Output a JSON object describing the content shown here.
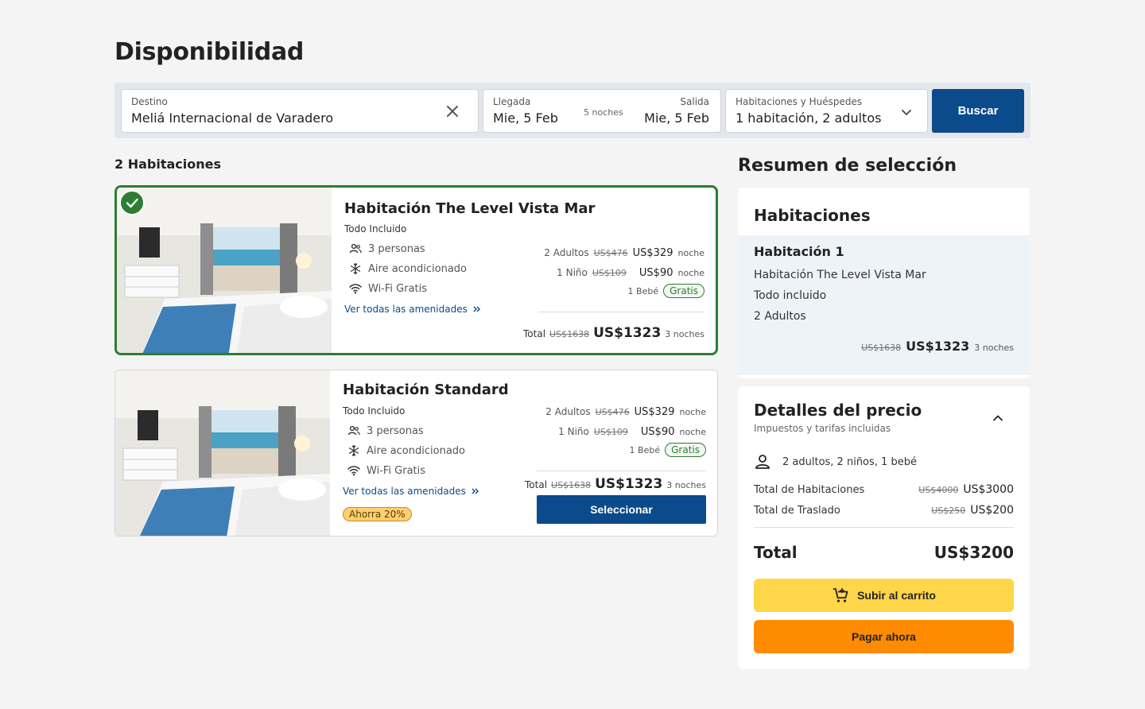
{
  "page": {
    "title": "Disponibilidad"
  },
  "search": {
    "destination": {
      "label": "Destino",
      "value": "Meliá Internacional de Varadero"
    },
    "dates": {
      "checkin_label": "Llegada",
      "checkin_value": "Mie, 5 Feb",
      "nights": "5 noches",
      "checkout_label": "Salida",
      "checkout_value": "Mie, 5 Feb"
    },
    "rooms": {
      "label": "Habitaciones y Huéspedes",
      "value": "1 habitación, 2 adultos"
    },
    "button": "Buscar"
  },
  "results": {
    "count": "2 Habitaciones",
    "rooms": [
      {
        "name": "Habitación The Level Vista Mar",
        "plan": "Todo Incluido",
        "amenities": [
          "3 personas",
          "Aire acondicionado",
          "Wi-Fi Gratis"
        ],
        "amenities_link": "Ver todas las amenidades",
        "adults": {
          "label": "2 Adultos",
          "old": "US$476",
          "now": "US$329",
          "unit": "noche"
        },
        "child": {
          "label": "1 Niño",
          "old": "US$109",
          "now": "US$90",
          "unit": "noche"
        },
        "baby": {
          "label": "1 Bebé",
          "badge": "Gratis"
        },
        "total": {
          "label": "Total",
          "old": "US$1638",
          "now": "US$1323",
          "nights": "3 noches"
        }
      },
      {
        "name": "Habitación Standard",
        "plan": "Todo Incluido",
        "amenities": [
          "3 personas",
          "Aire acondicionado",
          "Wi-Fi Gratis"
        ],
        "amenities_link": "Ver todas las amenidades",
        "promo": "Ahorra 20%",
        "adults": {
          "label": "2 Adultos",
          "old": "US$476",
          "now": "US$329",
          "unit": "noche"
        },
        "child": {
          "label": "1 Niño",
          "old": "US$109",
          "now": "US$90",
          "unit": "noche"
        },
        "baby": {
          "label": "1 Bebé",
          "badge": "Gratis"
        },
        "total": {
          "label": "Total",
          "old": "US$1638",
          "now": "US$1323",
          "nights": "3 noches"
        },
        "button": "Seleccionar"
      }
    ]
  },
  "summary": {
    "title": "Resumen de selección",
    "rooms_heading": "Habitaciones",
    "selection": {
      "title": "Habitación 1",
      "room": "Habitación The Level Vista Mar",
      "plan": "Todo incluido",
      "guests": "2 Adultos",
      "old": "US$1638",
      "now": "US$1323",
      "nights": "3 noches"
    },
    "price_details": {
      "title": "Detalles del precio",
      "subtitle": "Impuestos y tarifas incluidas",
      "guests": "2 adultos, 2 niños, 1 bebé",
      "rooms_total": {
        "label": "Total de Habitaciones",
        "old": "US$4000",
        "now": "US$3000"
      },
      "transfer_total": {
        "label": "Total de Traslado",
        "old": "US$250",
        "now": "US$200"
      },
      "total_label": "Total",
      "total_value": "US$3200",
      "cart_button": "Subir al carrito",
      "pay_button": "Pagar ahora"
    }
  },
  "colors": {
    "primary": "#0b4a8b",
    "selected": "#2e7d32",
    "cart": "#ffd54a",
    "pay": "#ff8c00",
    "promo": "#ffcf70"
  }
}
